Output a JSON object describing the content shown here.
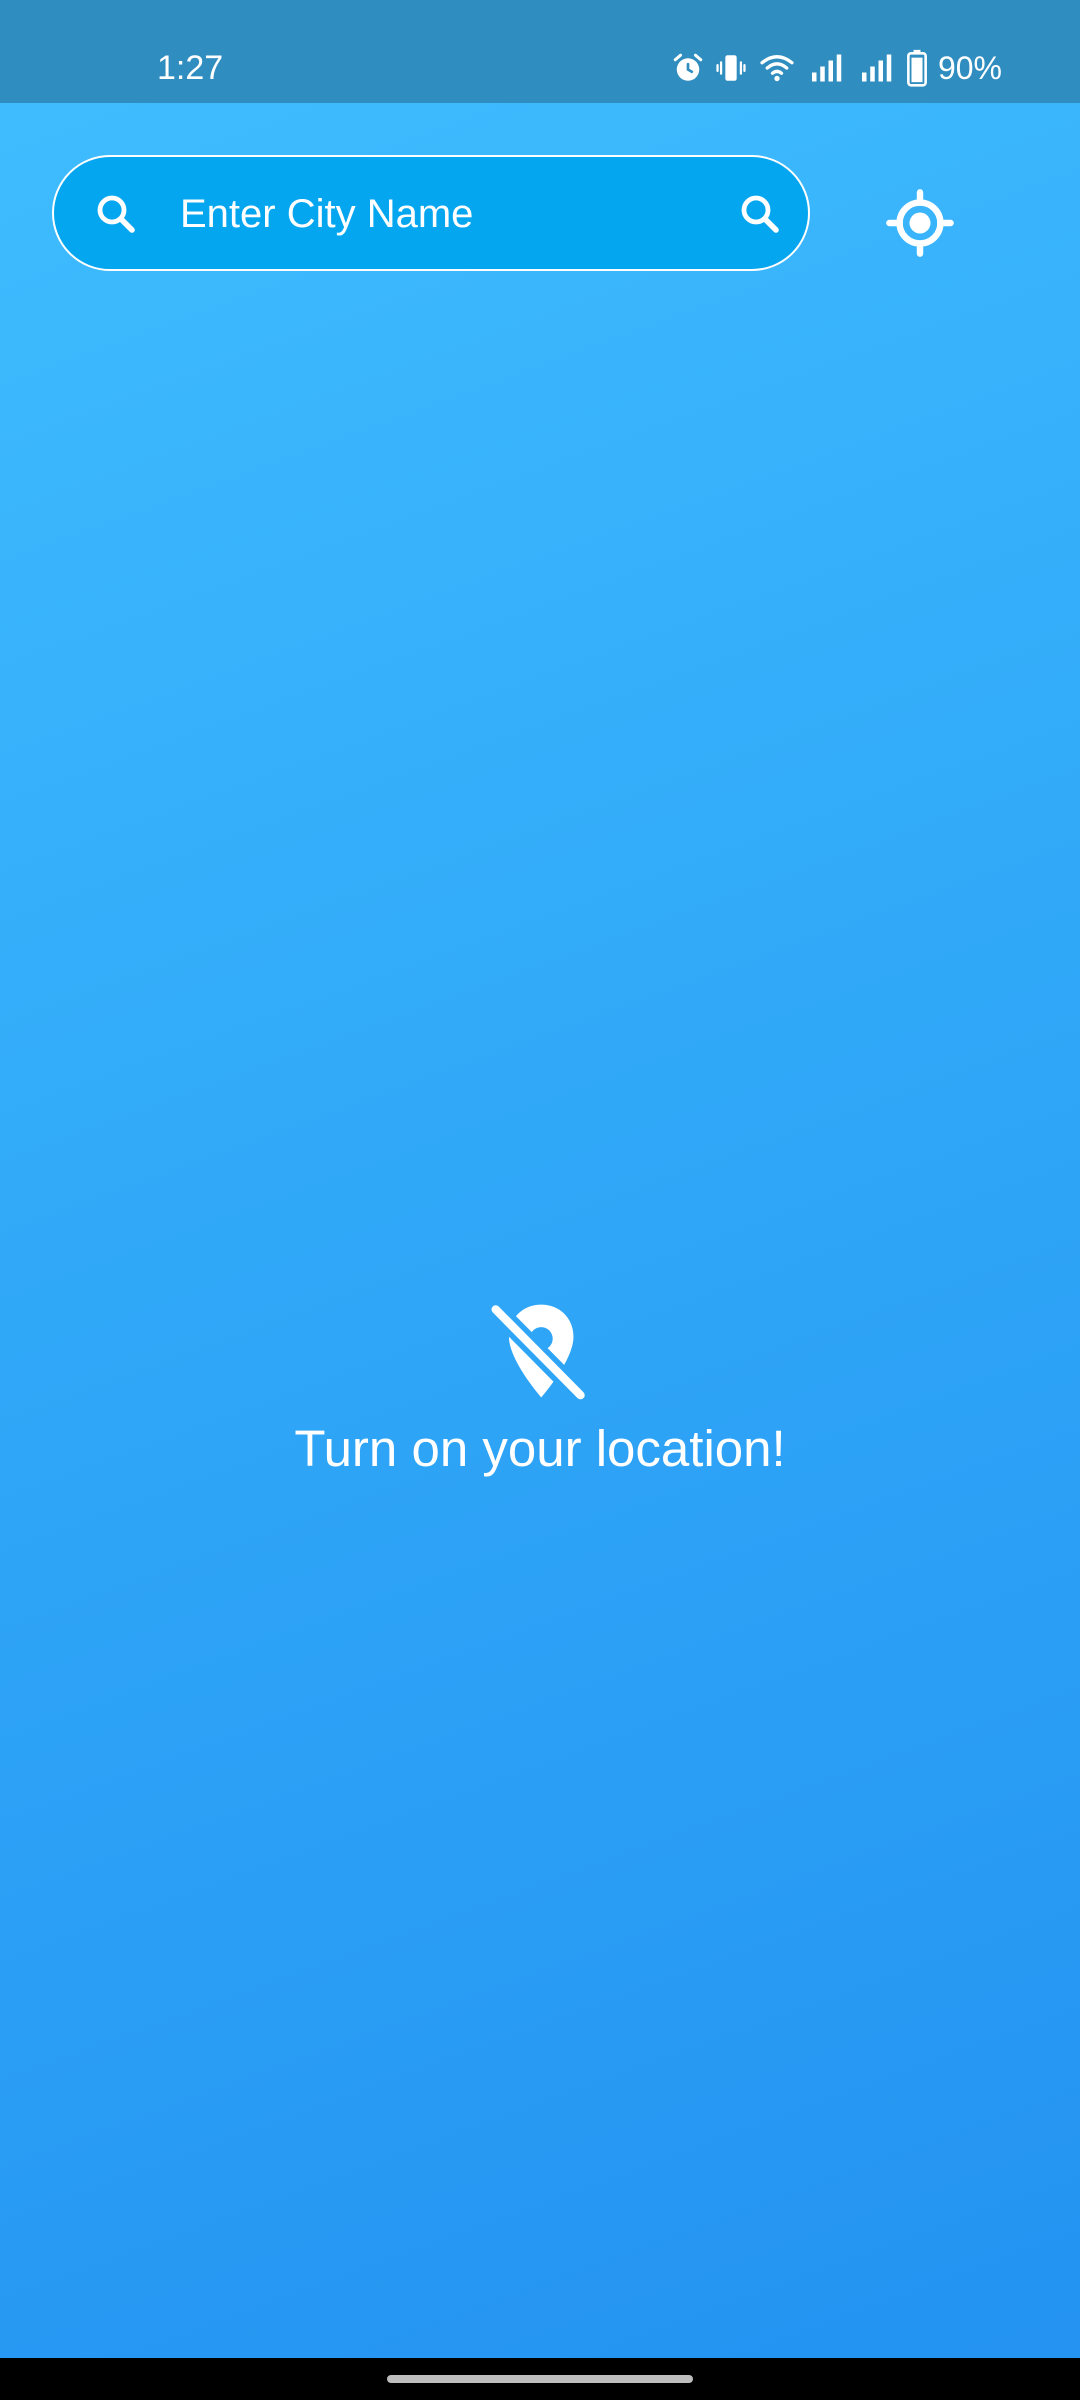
{
  "status_bar": {
    "time": "1:27",
    "battery_percent": "90%",
    "icons": [
      "alarm-icon",
      "vibrate-icon",
      "wifi-icon",
      "signal-icon",
      "signal-icon",
      "battery-icon"
    ]
  },
  "search": {
    "placeholder": "Enter City Name",
    "value": "",
    "left_icon": "search-icon",
    "right_icon": "search-icon"
  },
  "locate": {
    "icon": "my-location-icon"
  },
  "empty_state": {
    "icon": "location-off-icon",
    "message": "Turn on your location!"
  },
  "colors": {
    "background_top": "#40BEFF",
    "background_bottom": "#2392F1",
    "status_bar": "#2F8DBF",
    "search_fill": "#05A6F0",
    "foreground": "#FFFFFF"
  }
}
